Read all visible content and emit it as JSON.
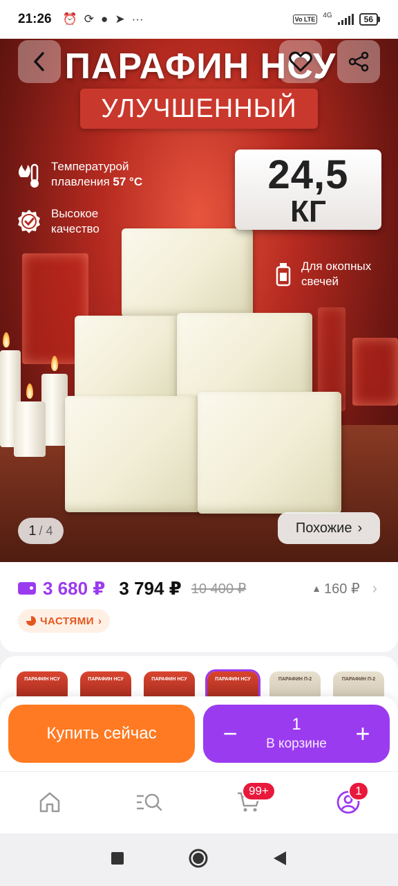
{
  "status_bar": {
    "time": "21:26",
    "network": "4G",
    "volte": "Vo LTE",
    "battery": "56"
  },
  "hero": {
    "title": "ПАРАФИН НСУ",
    "subtitle": "УЛУЧШЕННЫЙ",
    "feature_temp_prefix": "Температурой",
    "feature_temp_line2": "плавления",
    "feature_temp_value": "57 °C",
    "feature_quality_line1": "Высокое",
    "feature_quality_line2": "качество",
    "feature_candles_line1": "Для окопных",
    "feature_candles_line2": "свечей",
    "weight_value": "24,5",
    "weight_unit": "КГ",
    "counter_current": "1",
    "counter_total": "/ 4",
    "similar_label": "Похожие"
  },
  "price": {
    "card_price": "3 680 ₽",
    "main_price": "3 794 ₽",
    "old_price": "10 400 ₽",
    "diff": "160 ₽",
    "parts_label": "ЧАСТЯМИ"
  },
  "thumbnails": [
    {
      "label": "ПАРАФИН НСУ",
      "style": "red"
    },
    {
      "label": "ПАРАФИН НСУ",
      "style": "red"
    },
    {
      "label": "ПАРАФИН НСУ",
      "style": "red"
    },
    {
      "label": "ПАРАФИН НСУ",
      "style": "red",
      "selected": true
    },
    {
      "label": "ПАРАФИН П-2",
      "style": "light"
    },
    {
      "label": "ПАРАФИН П-2",
      "style": "light"
    }
  ],
  "actions": {
    "buy_now": "Купить сейчас",
    "minus": "−",
    "plus": "+",
    "qty": "1",
    "in_cart": "В корзине"
  },
  "bottom_nav": {
    "cart_badge": "99+",
    "profile_badge": "1"
  },
  "colors": {
    "accent": "#9b3bf0",
    "buy": "#ff7a22",
    "badge": "#e8193c"
  }
}
